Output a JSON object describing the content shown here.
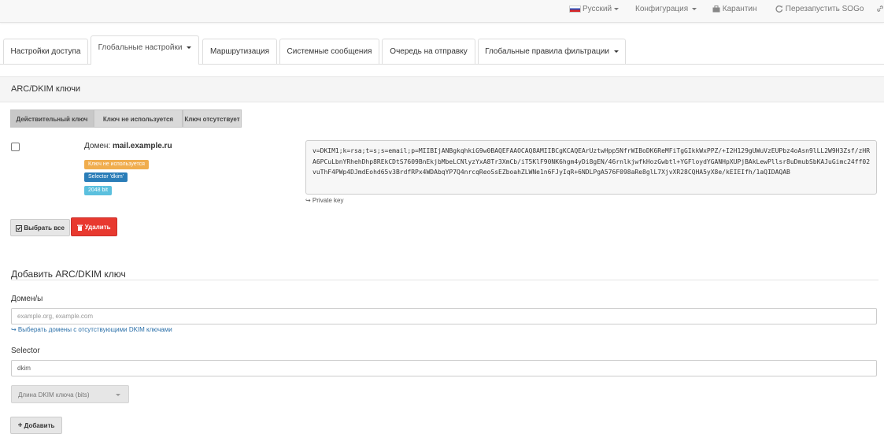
{
  "navbar": {
    "language": "Русский",
    "configuration": "Конфигурация",
    "quarantine": "Карантин",
    "restart_sogo": "Перезапустить SOGo"
  },
  "tabs": [
    {
      "label": "Настройки доступа"
    },
    {
      "label": "Глобальные настройки"
    },
    {
      "label": "Маршрутизация"
    },
    {
      "label": "Системные сообщения"
    },
    {
      "label": "Очередь на отправку"
    },
    {
      "label": "Глобальные правила фильтрации"
    }
  ],
  "panel": {
    "title": "ARC/DKIM ключи",
    "filters": [
      "Действительный ключ",
      "Ключ не используется",
      "Ключ отсутствует"
    ],
    "entry": {
      "domain_label": "Домен:",
      "domain": "mail.example.ru",
      "status_badge": "Ключ не используется",
      "selector_badge": "Selector 'dkim'",
      "bits_badge": "2048 bit",
      "key_text": "v=DKIM1;k=rsa;t=s;s=email;p=MIIBIjANBgkqhkiG9w0BAQEFAAOCAQ8AMIIBCgKCAQEArUztwHpp5NfrWIBoDK6ReMFiTgGIkkWxPPZ/+I2H129gUWuVzEUPbz4oAsn9lLL2W9H3Zsf/zHRA6PCuLbnYRhehDhp8REkCDtS7609BnEkjbMbeLCNlyzYxA8Tr3XmCb/iT5KlF90NK6hgm4yDi8gEN/46rnlkjwfkHozGwbtl+YGFloydYGANHpXUPjBAkLewPllsr8uDmubSbKAJuGimc24ff02vuThF4PWp4DJmdEohd65v3BrdfRPx4WDAbqYP7Q4nrcqReoSsEZboahZLWNe1n6FJyIqR+6NDLPgA576F098aRe8glL7XjvXR28CQHA5yX8e/kEIEIfh/1aQIDAQAB",
      "private_key": "↪ Private key"
    },
    "select_all": "Выбрать все",
    "delete": "Удалить"
  },
  "add_form": {
    "legend": "Добавить ARC/DKIM ключ",
    "domains_label": "Домен/ы",
    "domains_placeholder": "example.org, example.com",
    "help_link": "↪ Выберать домены с отсутствующими DKIM ключами",
    "selector_label": "Selector",
    "selector_value": "dkim",
    "key_length_placeholder": "Длина DKIM ключа (bits)",
    "add_button": "Добавить"
  },
  "colors": {
    "danger": "#e8392f",
    "warning": "#f0ad4e",
    "primary": "#2a7db8",
    "info": "#5bc0de",
    "link": "#2a6fa8"
  }
}
